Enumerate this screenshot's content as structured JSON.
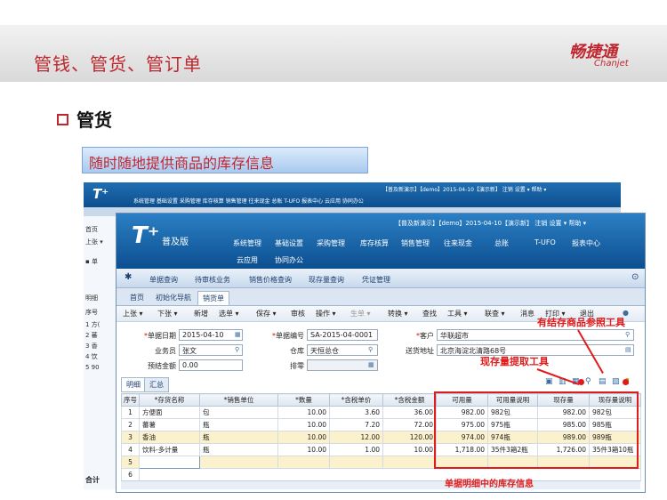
{
  "slide": {
    "title": "管钱、管货、管订单",
    "brand": "畅捷通",
    "brand_en": "Chanjet",
    "section": "管货",
    "subtitle": "随时随地提供商品的库存信息"
  },
  "back_window": {
    "logo": "T⁺",
    "status": "【普及新演示】【demo】2015-04-10【演示新】 注销 设置 ▾ 帮助 ▾",
    "menu": "系统管理  基础设置  采购管理  库存核算  销售管理  往来现金  总账  T-UFO  报表中心  云应用  协同办公",
    "left_items": [
      "首页",
      "上张 ▾",
      "▪ 单",
      "明细",
      "序号",
      "1  方(",
      "2  蕃",
      "3  香",
      "4  饮",
      "5  90"
    ],
    "total_label": "合计"
  },
  "app": {
    "logo": "T⁺",
    "edition": "普及版",
    "status": "【普及新演示】【demo】2015-04-10【演示新】 注销 设置 ▾ 帮助 ▾",
    "menu_row1": [
      "系统管理",
      "基础设置",
      "采购管理",
      "库存核算",
      "销售管理",
      "往来现金",
      "总账",
      "T-UFO",
      "报表中心"
    ],
    "menu_row2": [
      "云应用",
      "协同办公"
    ],
    "nav": [
      "单据查询",
      "待审核业务",
      "销售价格查询",
      "现存量查询",
      "凭证管理"
    ],
    "tabs": [
      "首页",
      "初始化导航",
      "销货单"
    ],
    "toolbar": [
      "上张 ▾",
      "下张 ▾",
      "新增",
      "选单 ▾",
      "保存 ▾",
      "审核",
      "操作 ▾",
      "生单 ▾",
      "转换 ▾",
      "查找",
      "工具 ▾",
      "联查 ▾",
      "消息",
      "打印 ▾",
      "退出"
    ],
    "form": {
      "date_label": "单据日期",
      "date_value": "2015-04-10",
      "code_label": "单据编号",
      "code_value": "SA-2015-04-0001",
      "customer_label": "客户",
      "customer_value": "华联超市",
      "salesman_label": "业务员",
      "salesman_value": "张文",
      "warehouse_label": "仓库",
      "warehouse_value": "天恒总仓",
      "address_label": "送货地址",
      "address_value": "北京海淀北清路68号",
      "presettle_label": "预结金额",
      "presettle_value": "0.00",
      "queue_label": "排零"
    },
    "detail_tabs": [
      "明细",
      "汇总"
    ],
    "grid": {
      "headers": [
        "序号",
        "*存货名称",
        "*销售单位",
        "*数量",
        "*含税单价",
        "*含税金额",
        "可用量",
        "可用量说明",
        "现存量",
        "现存量说明"
      ],
      "rows": [
        [
          "1",
          "方便面",
          "包",
          "10.00",
          "3.60",
          "36.00",
          "982.00",
          "982包",
          "982.00",
          "982包"
        ],
        [
          "2",
          "蕃薯",
          "瓶",
          "10.00",
          "7.20",
          "72.00",
          "975.00",
          "975瓶",
          "985.00",
          "985瓶"
        ],
        [
          "3",
          "香油",
          "瓶",
          "10.00",
          "12.00",
          "120.00",
          "974.00",
          "974瓶",
          "989.00",
          "989瓶"
        ],
        [
          "4",
          "饮料-多计量",
          "瓶",
          "10.00",
          "1.00",
          "10.00",
          "1,718.00",
          "35件3箱2瓶",
          "1,726.00",
          "35件3箱10瓶"
        ],
        [
          "5",
          "",
          "",
          "",
          "",
          "",
          "",
          "",
          "",
          ""
        ]
      ]
    }
  },
  "annotations": {
    "stock_ref_tool": "有结存商品参照工具",
    "stock_fetch_tool": "现存量提取工具",
    "detail_stock_info": "单据明细中的库存信息"
  },
  "colors": {
    "brand_red": "#c0262d",
    "header_blue": "#0c4f90",
    "annotation_red": "#e01b1b",
    "highlight_row": "#fbf1cc"
  }
}
